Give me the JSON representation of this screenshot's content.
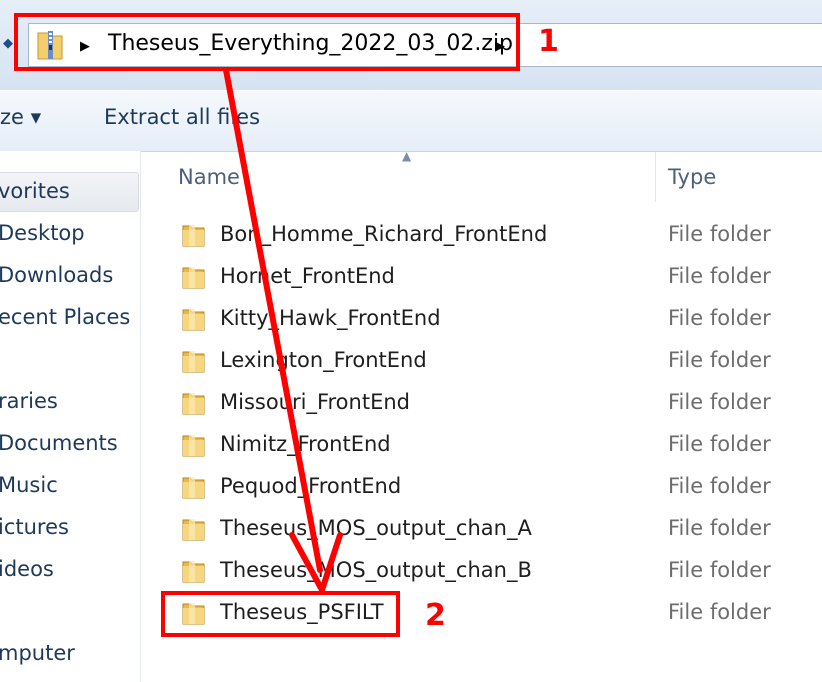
{
  "address_bar": {
    "breadcrumb": "Theseus_Everything_2022_03_02.zip",
    "separator_glyph": "▶",
    "dropdown_glyph": "◆"
  },
  "toolbar": {
    "organize_label": "ze ▾",
    "extract_all_label": "Extract all files"
  },
  "nav_pane": {
    "favorites": "vorites",
    "items": [
      "Desktop",
      "Downloads",
      "ecent Places",
      "raries",
      "Documents",
      "Music",
      "ictures",
      "ideos",
      "mputer"
    ]
  },
  "file_list": {
    "columns": [
      "Name",
      "Type"
    ],
    "sort_glyph": "▲",
    "rows": [
      {
        "name": "Bon_Homme_Richard_FrontEnd",
        "type": "File folder"
      },
      {
        "name": "Hornet_FrontEnd",
        "type": "File folder"
      },
      {
        "name": "Kitty_Hawk_FrontEnd",
        "type": "File folder"
      },
      {
        "name": "Lexington_FrontEnd",
        "type": "File folder"
      },
      {
        "name": "Missouri_FrontEnd",
        "type": "File folder"
      },
      {
        "name": "Nimitz_FrontEnd",
        "type": "File folder"
      },
      {
        "name": "Pequod_FrontEnd",
        "type": "File folder"
      },
      {
        "name": "Theseus_MOS_output_chan_A",
        "type": "File folder"
      },
      {
        "name": "Theseus_MOS_output_chan_B",
        "type": "File folder"
      },
      {
        "name": "Theseus_PSFILT",
        "type": "File folder"
      }
    ]
  },
  "annotations": {
    "marker_1": "1",
    "marker_2": "2",
    "color": "#ff0000"
  }
}
